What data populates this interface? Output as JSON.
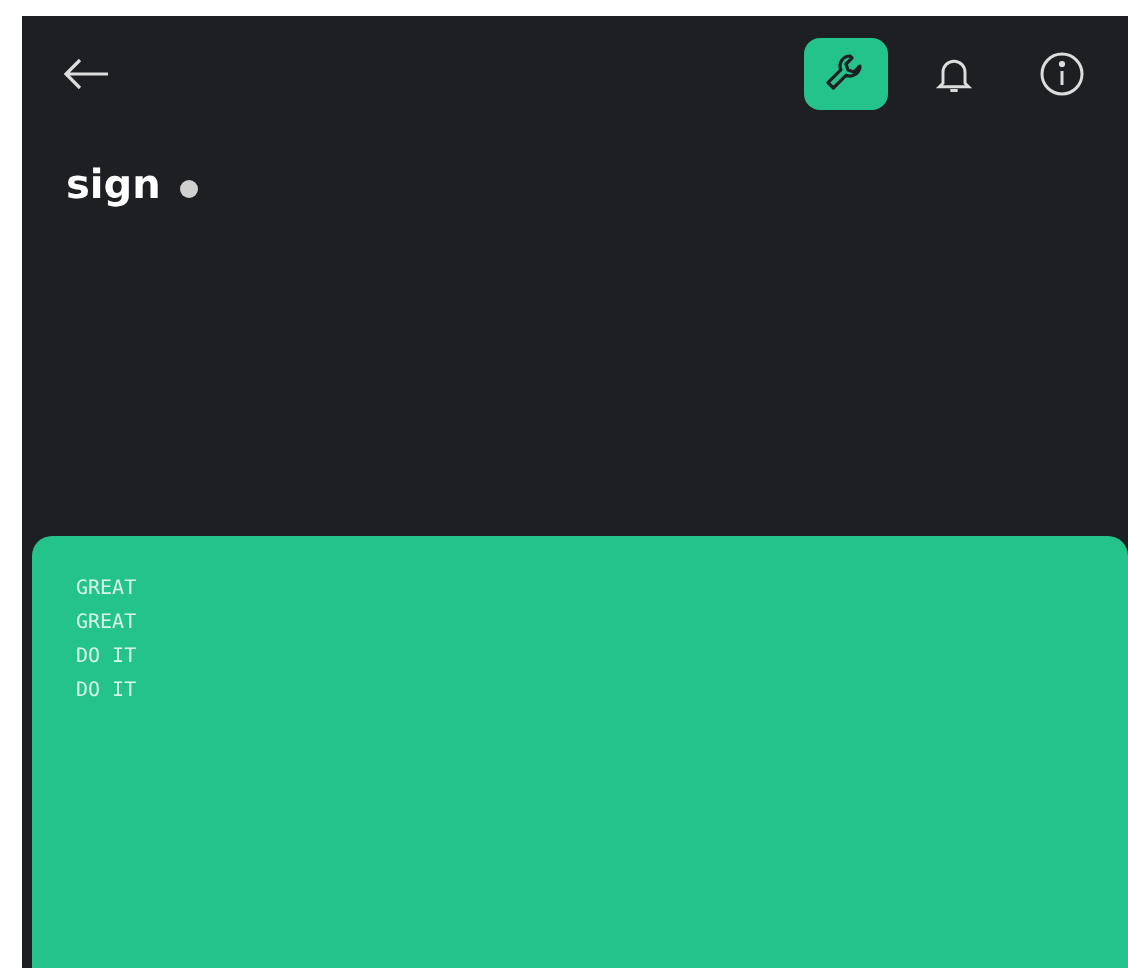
{
  "title": "sign",
  "actions": [
    {
      "kind": "wrench",
      "selected": true
    },
    {
      "kind": "bell",
      "selected": false
    },
    {
      "kind": "info",
      "selected": false
    }
  ],
  "terminal": {
    "lines": [
      "GREAT",
      "GREAT",
      "DO IT",
      "DO IT"
    ]
  }
}
